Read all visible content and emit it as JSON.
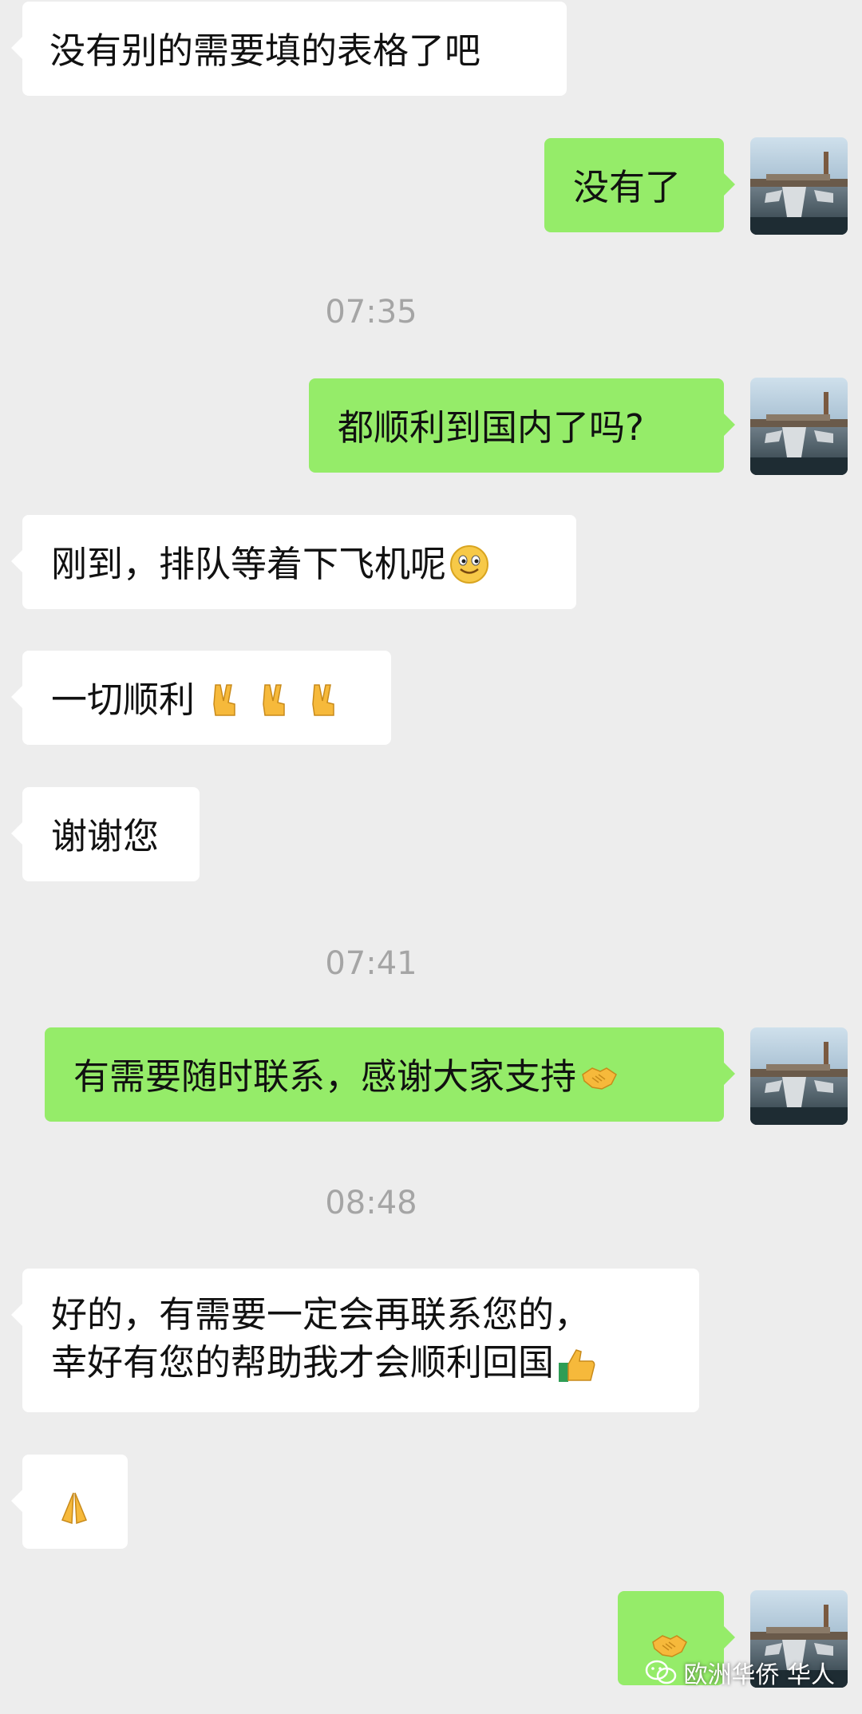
{
  "messages": [
    {
      "side": "left",
      "text": "没有别的需要填的表格了吧"
    },
    {
      "side": "right",
      "text": "没有了"
    },
    {
      "time": "07:35"
    },
    {
      "side": "right",
      "text": "都顺利到国内了吗?"
    },
    {
      "side": "left",
      "text": "刚到，排队等着下飞机呢",
      "emoji": "slightly-smiling-face"
    },
    {
      "side": "left",
      "text": "一切顺利",
      "emoji": "victory-hand x3"
    },
    {
      "side": "left",
      "text": "谢谢您"
    },
    {
      "time": "07:41"
    },
    {
      "side": "right",
      "text": "有需要随时联系，感谢大家支持",
      "emoji": "handshake"
    },
    {
      "time": "08:48"
    },
    {
      "side": "left",
      "line1": "好的，有需要一定会再联系您的，",
      "line2": "幸好有您的帮助我才会顺利回国",
      "emoji": "thumbs-up"
    },
    {
      "side": "left",
      "emoji": "folded-hands"
    },
    {
      "side": "right",
      "emoji": "handshake"
    }
  ],
  "watermark": {
    "text": "欧洲华侨 华人",
    "icon": "wechat-icon"
  },
  "colors": {
    "background": "#ededed",
    "left_bubble": "#ffffff",
    "right_bubble": "#95ec69",
    "time": "#a5a5a5"
  }
}
